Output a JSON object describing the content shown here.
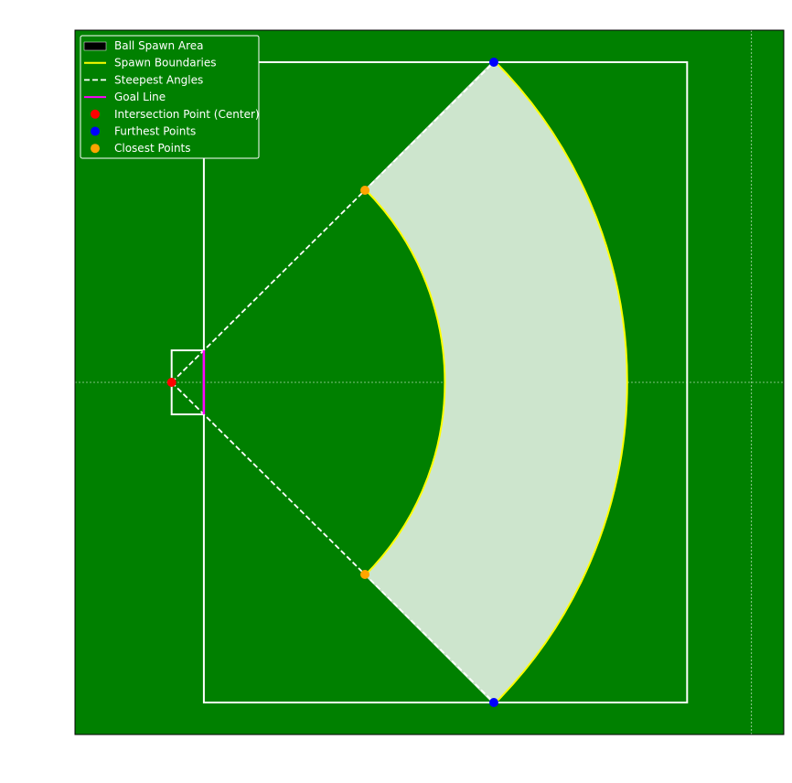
{
  "chart_data": {
    "type": "area",
    "title": "",
    "xlabel": "",
    "ylabel": "",
    "xlim": [
      -10,
      100
    ],
    "ylim": [
      -55,
      55
    ],
    "grid": false,
    "legend_placement": "top-left",
    "colors": {
      "field": "#008000",
      "spawn_fill": "#cde5cd",
      "spawn_boundary": "#ffff00",
      "field_lines": "#ffffff",
      "steepest_angles": "#ffffff",
      "goal_line": "#ff00ff",
      "center_point": "#ff0000",
      "furthest_points": "#0000ff",
      "closest_points": "#ffa500",
      "legend_bg": "#008000",
      "legend_border": "#ffffff"
    },
    "field": {
      "pitch_rect": {
        "x": [
          10,
          85
        ],
        "y": [
          -50,
          50
        ]
      },
      "goal_box": {
        "x": [
          5,
          10
        ],
        "y": [
          -5,
          5
        ]
      },
      "center_line_x": 95,
      "center_line_y": 0
    },
    "intersection_point": {
      "x": 5,
      "y": 0
    },
    "goal_line": {
      "x": 10,
      "y": [
        -5,
        5
      ]
    },
    "spawn_area": {
      "center": [
        5,
        0
      ],
      "inner_radius": 42.4,
      "outer_radius": 70.7,
      "angle_range_deg": [
        -45,
        45
      ]
    },
    "furthest_points": [
      {
        "x": 55,
        "y": 50
      },
      {
        "x": 55,
        "y": -50
      }
    ],
    "closest_points": [
      {
        "x": 35,
        "y": 30
      },
      {
        "x": 35,
        "y": -30
      }
    ],
    "steepest_angles": [
      {
        "from": [
          5,
          0
        ],
        "to": [
          55,
          50
        ]
      },
      {
        "from": [
          5,
          0
        ],
        "to": [
          55,
          -50
        ]
      }
    ],
    "legend": [
      {
        "key": "spawn_area",
        "label": "Ball Spawn Area",
        "marker": "patch"
      },
      {
        "key": "spawn_boundary",
        "label": "Spawn Boundaries",
        "marker": "line"
      },
      {
        "key": "steepest_angles",
        "label": "Steepest Angles",
        "marker": "dashed"
      },
      {
        "key": "goal_line",
        "label": "Goal Line",
        "marker": "line"
      },
      {
        "key": "center_point",
        "label": "Intersection Point (Center)",
        "marker": "dot"
      },
      {
        "key": "furthest_points",
        "label": "Furthest Points",
        "marker": "dot"
      },
      {
        "key": "closest_points",
        "label": "Closest Points",
        "marker": "dot"
      }
    ]
  }
}
